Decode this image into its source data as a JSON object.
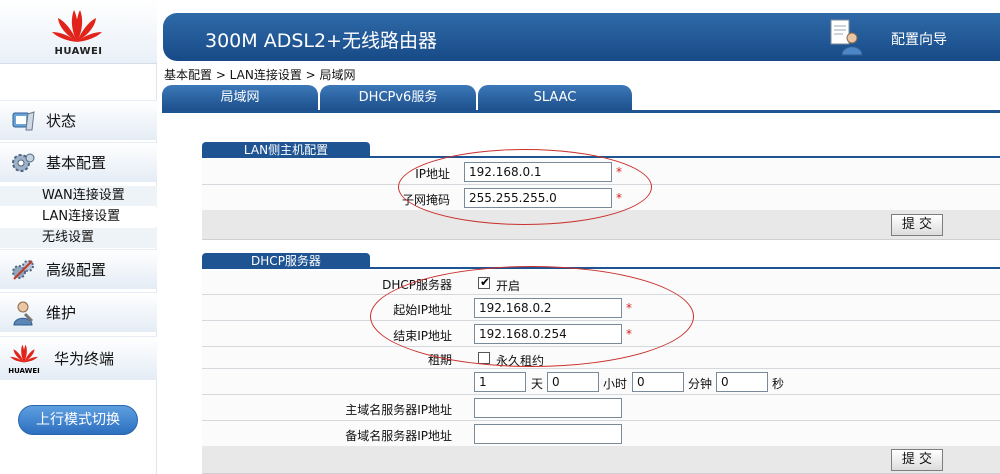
{
  "brand": {
    "name": "HUAWEI",
    "sub_brand": "HUAWEI"
  },
  "sidebar": {
    "items": [
      {
        "label": "状态",
        "icon": "status-icon"
      },
      {
        "label": "基本配置",
        "icon": "gear-icon"
      },
      {
        "label": "高级配置",
        "icon": "advanced-config-icon"
      },
      {
        "label": "维护",
        "icon": "maintenance-icon"
      },
      {
        "label": "华为终端",
        "icon": "huawei-logo-icon"
      }
    ],
    "sub_items": [
      {
        "label": "WAN连接设置"
      },
      {
        "label": "LAN连接设置",
        "active": true
      },
      {
        "label": "无线设置"
      }
    ],
    "mode_switch": "上行模式切换"
  },
  "header": {
    "title": "300M ADSL2+无线路由器",
    "wizard_label": "配置向导",
    "wizard_icon": "wizard-user-icon"
  },
  "breadcrumb": "基本配置 > LAN连接设置 > 局域网",
  "tabs": [
    {
      "label": "局域网",
      "active": true
    },
    {
      "label": "DHCPv6服务"
    },
    {
      "label": "SLAAC"
    }
  ],
  "lan_host": {
    "section_title": "LAN侧主机配置",
    "ip_label": "IP地址",
    "ip_value": "192.168.0.1",
    "mask_label": "子网掩码",
    "mask_value": "255.255.255.0",
    "required_mark": "*",
    "submit": "提 交"
  },
  "dhcp": {
    "section_title": "DHCP服务器",
    "server_label": "DHCP服务器",
    "enable_label": "开启",
    "enabled": true,
    "start_label": "起始IP地址",
    "start_value": "192.168.0.2",
    "end_label": "结束IP地址",
    "end_value": "192.168.0.254",
    "lease_label": "租期",
    "permanent_label": "永久租约",
    "permanent": false,
    "lease_days": "1",
    "days_unit": "天",
    "lease_hours": "0",
    "hours_unit": "小时",
    "lease_minutes": "0",
    "minutes_unit": "分钟",
    "lease_seconds": "0",
    "seconds_unit": "秒",
    "dns1_label": "主域名服务器IP地址",
    "dns1_value": "",
    "dns2_label": "备域名服务器IP地址",
    "dns2_value": "",
    "required_mark": "*",
    "submit": "提 交"
  },
  "colors": {
    "header": "#1f5493",
    "accent_red": "#d21f1f",
    "highlight_ellipse": "#c9302c"
  }
}
